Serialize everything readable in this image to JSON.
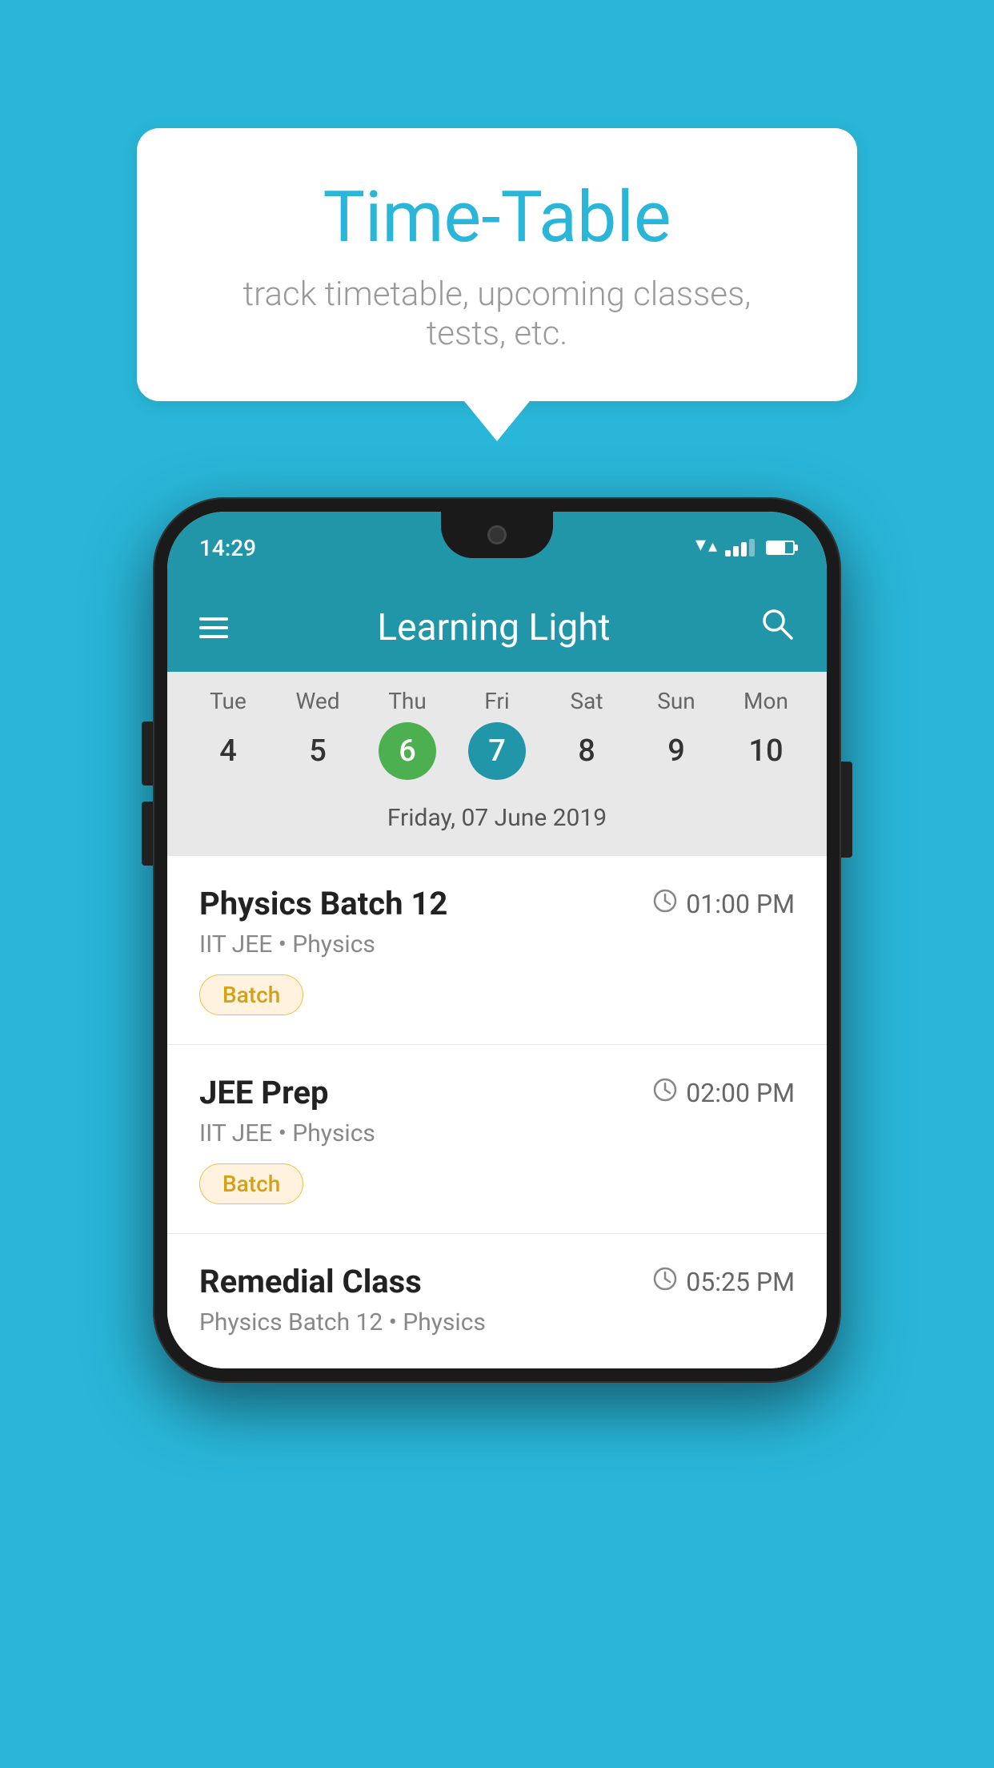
{
  "background_color": "#29b6d8",
  "bubble": {
    "title": "Time-Table",
    "subtitle": "track timetable, upcoming classes, tests, etc."
  },
  "phone": {
    "status_bar": {
      "time": "14:29"
    },
    "app_header": {
      "title": "Learning Light"
    },
    "calendar": {
      "days": [
        {
          "label": "Tue",
          "num": "4"
        },
        {
          "label": "Wed",
          "num": "5"
        },
        {
          "label": "Thu",
          "num": "6",
          "state": "today"
        },
        {
          "label": "Fri",
          "num": "7",
          "state": "selected"
        },
        {
          "label": "Sat",
          "num": "8"
        },
        {
          "label": "Sun",
          "num": "9"
        },
        {
          "label": "Mon",
          "num": "10"
        }
      ],
      "selected_date": "Friday, 07 June 2019"
    },
    "schedule": [
      {
        "title": "Physics Batch 12",
        "time": "01:00 PM",
        "meta": "IIT JEE • Physics",
        "badge": "Batch"
      },
      {
        "title": "JEE Prep",
        "time": "02:00 PM",
        "meta": "IIT JEE • Physics",
        "badge": "Batch"
      },
      {
        "title": "Remedial Class",
        "time": "05:25 PM",
        "meta": "Physics Batch 12 • Physics",
        "badge": null
      }
    ]
  }
}
